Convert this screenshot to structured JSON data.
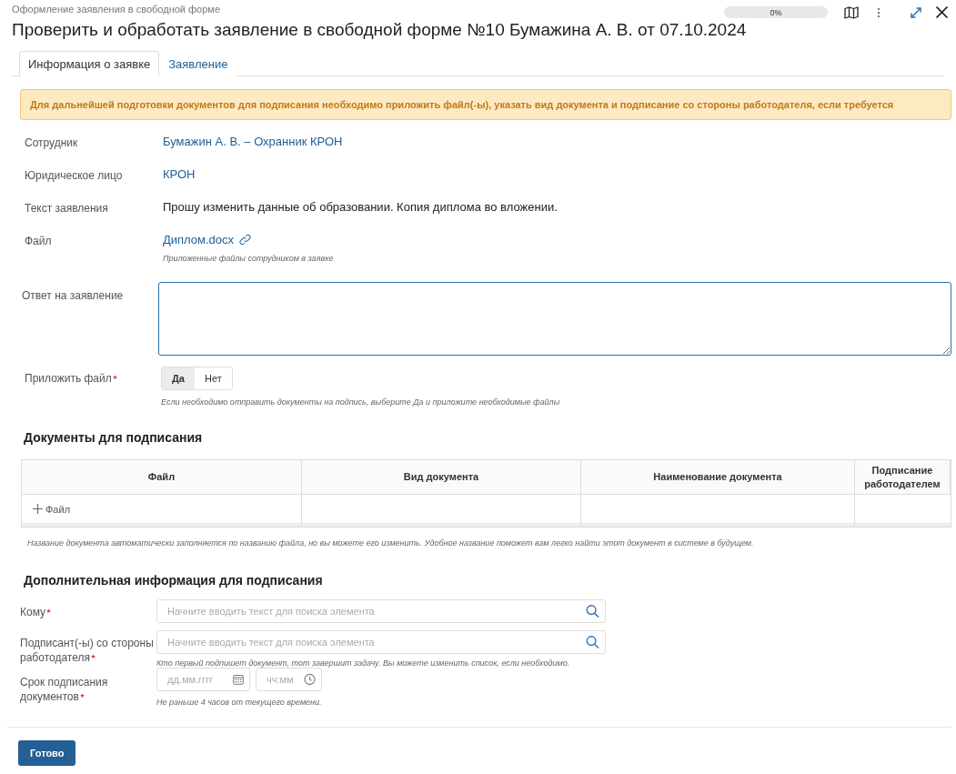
{
  "header": {
    "breadcrumb": "Оформление заявления в свободной форме",
    "title": "Проверить и обработать заявление в свободной форме №10 Бумажина А. В. от 07.10.2024",
    "progress": {
      "level": 0,
      "reading": "0%"
    }
  },
  "tabs": [
    {
      "label": "Информация о заявке",
      "selected": true
    },
    {
      "label": "Заявление",
      "selected": false
    }
  ],
  "alert": "Для дальнейшей подготовки документов для подписания необходимо приложить файл(-ы), указать вид документа и подписание со стороны работодателя, если требуется",
  "info_rows": [
    {
      "kind": "link",
      "label": "Сотрудник",
      "value": "Бумажин А. В. – Охранник КРОН"
    },
    {
      "kind": "link",
      "label": "Юридическое лицо",
      "value": "КРОН"
    },
    {
      "kind": "text",
      "label": "Текст заявления",
      "value": "Прошу изменить данные об образовании. Копия диплома во вложении."
    },
    {
      "kind": "file",
      "label": "Файл",
      "value": "Диплом.docx",
      "hint": "Приложенные файлы сотрудником в заявке"
    }
  ],
  "answer": {
    "label": "Ответ на заявление"
  },
  "attach": {
    "label": "Приложить файл",
    "required": true,
    "options": [
      {
        "label": "Да",
        "selected": true
      },
      {
        "label": "Нет",
        "selected": false
      }
    ],
    "hint": "Если необходимо отправить документы на подпись, выберите Да и приложите необходимые файлы"
  },
  "documents": {
    "title": "Документы для подписания",
    "columns": [
      "Файл",
      "Вид документа",
      "Наименование документа",
      "Подписание работодателем"
    ],
    "add_label": "Файл",
    "hint": "Название документа автоматически заполняется по названию файла, но вы можете его изменить. Удобное название поможет вам легко найти этот документ в системе в будущем."
  },
  "signing": {
    "title": "Дополнительная информация для подписания",
    "fields": [
      {
        "kind": "search",
        "label": "Кому",
        "required": true,
        "placeholder": "Начните вводить текст для поиска элемента"
      },
      {
        "kind": "search",
        "label": "Подписант(-ы) со стороны работодателя",
        "required": true,
        "placeholder": "Начните вводить текст для поиска элемента",
        "hint": "Кто первый подпишет документ, тот завершит задачу. Вы можете изменить список, если необходимо."
      },
      {
        "kind": "datetime",
        "label": "Срок подписания документов",
        "required": true,
        "date_placeholder": "дд.мм.гггг",
        "time_placeholder": "чч:мм",
        "hint": "Не раньше 4 часов от текущего времени."
      }
    ]
  },
  "footer": {
    "button": "Готово"
  }
}
